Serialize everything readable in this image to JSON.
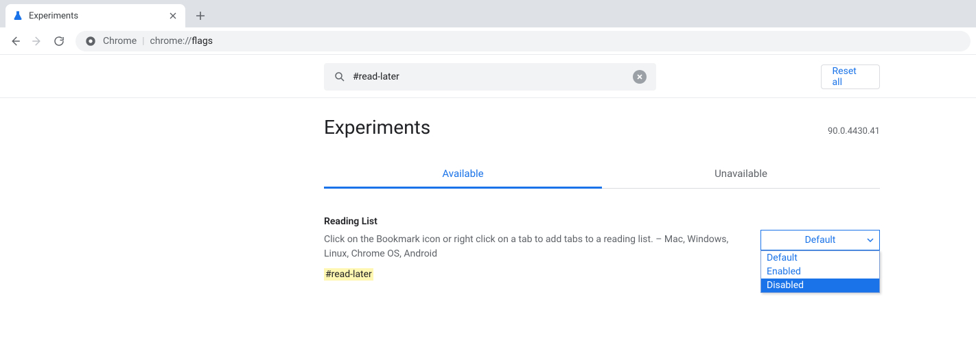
{
  "browser": {
    "tab_title": "Experiments",
    "url_prefix": "Chrome",
    "url_path1": "chrome://",
    "url_path2": "flags"
  },
  "search": {
    "value": "#read-later",
    "reset_label": "Reset all"
  },
  "page": {
    "title": "Experiments",
    "version": "90.0.4430.41"
  },
  "tabs": {
    "available": "Available",
    "unavailable": "Unavailable"
  },
  "flag": {
    "name": "Reading List",
    "description": "Click on the Bookmark icon or right click on a tab to add tabs to a reading list. – Mac, Windows, Linux, Chrome OS, Android",
    "hash": "#read-later",
    "selected": "Default",
    "options": {
      "0": "Default",
      "1": "Enabled",
      "2": "Disabled"
    }
  }
}
